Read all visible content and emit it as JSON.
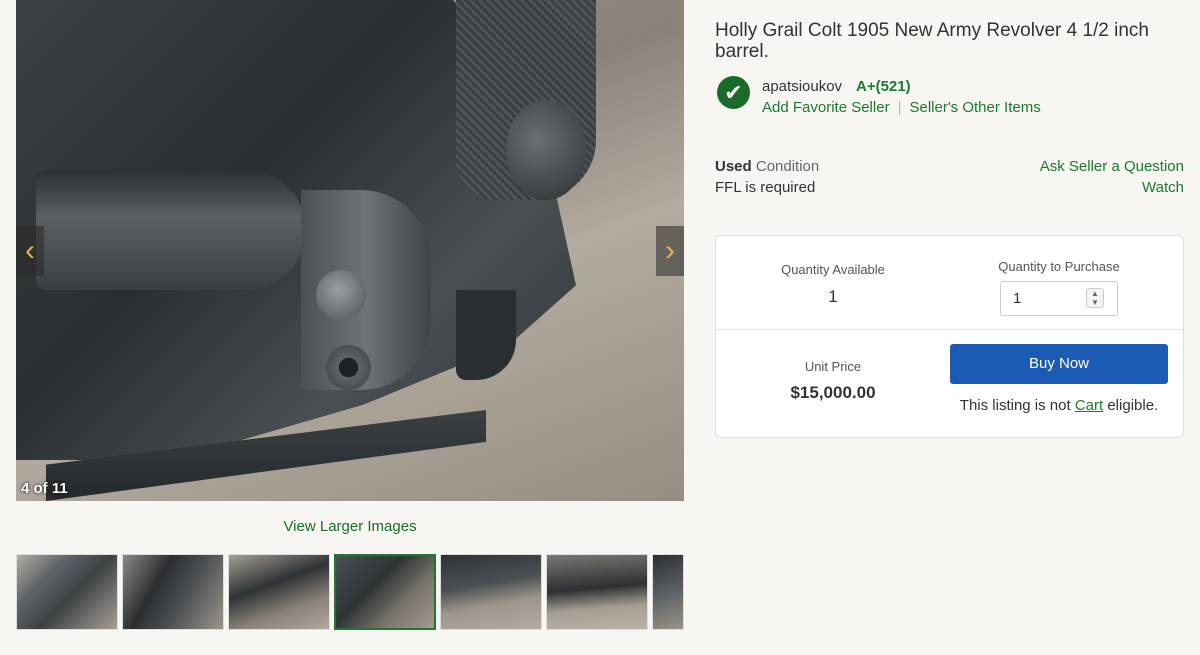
{
  "listing": {
    "title": "Holly Grail Colt 1905 New Army Revolver 4 1/2 inch barrel."
  },
  "gallery": {
    "counter": "4 of 11",
    "view_larger": "View Larger Images",
    "prev_icon": "chevron-left-icon",
    "next_icon": "chevron-right-icon",
    "thumbnails_visible": 7,
    "active_thumbnail": 4
  },
  "seller": {
    "name": "apatsioukov",
    "rating": "A+(521)",
    "add_favorite": "Add Favorite Seller",
    "separator": "|",
    "other_items": "Seller's Other Items",
    "verified_icon": "checkmark-badge-icon"
  },
  "condition": {
    "value": "Used",
    "label": "Condition",
    "ffl": "FFL is required"
  },
  "actions": {
    "ask_question": "Ask Seller a Question",
    "watch": "Watch"
  },
  "purchase": {
    "quantity_available_label": "Quantity Available",
    "quantity_available": "1",
    "quantity_to_purchase_label": "Quantity to Purchase",
    "quantity_to_purchase": "1",
    "unit_price_label": "Unit Price",
    "unit_price": "$15,000.00",
    "buy_now": "Buy Now",
    "cart_note_prefix": "This listing is not ",
    "cart_link": "Cart",
    "cart_note_suffix": " eligible."
  },
  "colors": {
    "accent_green": "#1b7a2c",
    "buy_button": "#1c5bb5",
    "background": "#f7f6f3"
  }
}
